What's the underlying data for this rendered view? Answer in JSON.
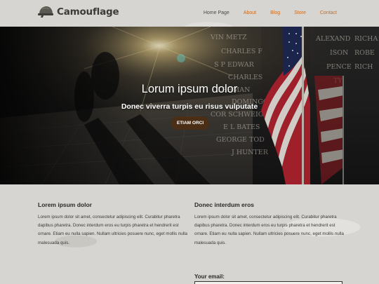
{
  "header": {
    "logo_text": "Camouflage",
    "nav": [
      "Home Page",
      "About",
      "Blog",
      "Store",
      "Contact"
    ]
  },
  "hero": {
    "title": "Lorum ipsum dolor",
    "subtitle": "Donec viverra turpis eu risus vulputate",
    "button_label": "ETIAM ORCI",
    "wall_names": [
      "VIN METZ",
      "CHARLES F",
      "S P EDWAR",
      "CHARLES",
      "LEHMAN",
      "DOMINGO",
      "COR SCHWEIG",
      "E L BATES",
      "GEORGE TOD",
      "J HUNTER",
      "ALEXAND",
      "ISON",
      "PENCE",
      "TY",
      "RICHA",
      "ROBE",
      "RICH"
    ]
  },
  "columns": [
    {
      "heading": "Lorem ipsum dolor",
      "text": "Lorem ipsum dolor sit amet, consectetur adipiscing elit. Curabitur pharetra dapibus pharetra. Donec interdum eros eu turpis pharetra et hendrerit est ornare. Etiam eu nulla sapien. Nullam ultricies posuere nunc, eget mollis nulla malesuada quis."
    },
    {
      "heading": "Donec interdum eros",
      "text": "Lorem ipsum dolor sit amet, consectetur adipiscing elit. Curabitur pharetra dapibus pharetra. Donec interdum eros eu turpis pharetra et hendrerit est ornare. Etiam eu nulla sapien. Nullam ultricies posuere nunc, eget mollis nulla malesuada quis."
    }
  ],
  "form": {
    "email_label": "Your email:",
    "email_value": ""
  },
  "colors": {
    "accent": "#c96b1f",
    "button": "#4a2e16",
    "background": "#d9d8d4"
  },
  "icons": {
    "logo": "army-helmet-icon"
  }
}
